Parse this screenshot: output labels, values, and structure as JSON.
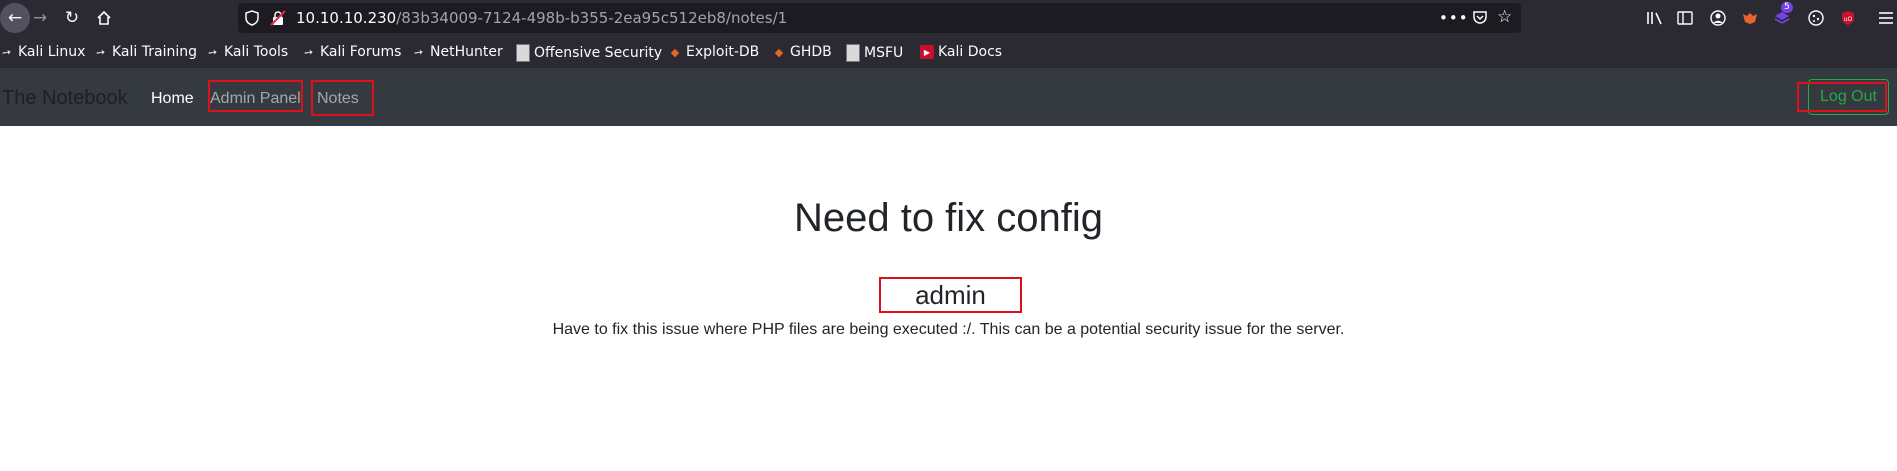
{
  "browser": {
    "url_host": "10.10.10.230",
    "url_path": "/83b34009-7124-498b-b355-2ea95c512eb8/notes/1",
    "extension_badge": "5",
    "bookmarks": [
      {
        "label": "Kali Linux",
        "icon": "kali-dragon-icon"
      },
      {
        "label": "Kali Training",
        "icon": "kali-dragon-icon"
      },
      {
        "label": "Kali Tools",
        "icon": "kali-dragon-icon"
      },
      {
        "label": "Kali Forums",
        "icon": "kali-dragon-icon"
      },
      {
        "label": "NetHunter",
        "icon": "kali-dragon-icon"
      },
      {
        "label": "Offensive Security",
        "icon": "offsec-icon"
      },
      {
        "label": "Exploit-DB",
        "icon": "exploitdb-icon"
      },
      {
        "label": "GHDB",
        "icon": "exploitdb-icon"
      },
      {
        "label": "MSFU",
        "icon": "offsec-icon"
      },
      {
        "label": "Kali Docs",
        "icon": "kali-docs-icon"
      }
    ]
  },
  "site": {
    "brand": "The Notebook",
    "nav": {
      "home": "Home",
      "admin_panel": "Admin Panel",
      "notes": "Notes",
      "logout": "Log Out"
    }
  },
  "note": {
    "title": "Need to fix config",
    "author": "admin",
    "body": "Have to fix this issue where PHP files are being executed :/. This can be a potential security issue for the server."
  },
  "colors": {
    "navbar_bg": "#343a40",
    "highlight_box": "#e0101a",
    "logout_green": "#28a745",
    "browser_chrome": "#2b2a33"
  }
}
